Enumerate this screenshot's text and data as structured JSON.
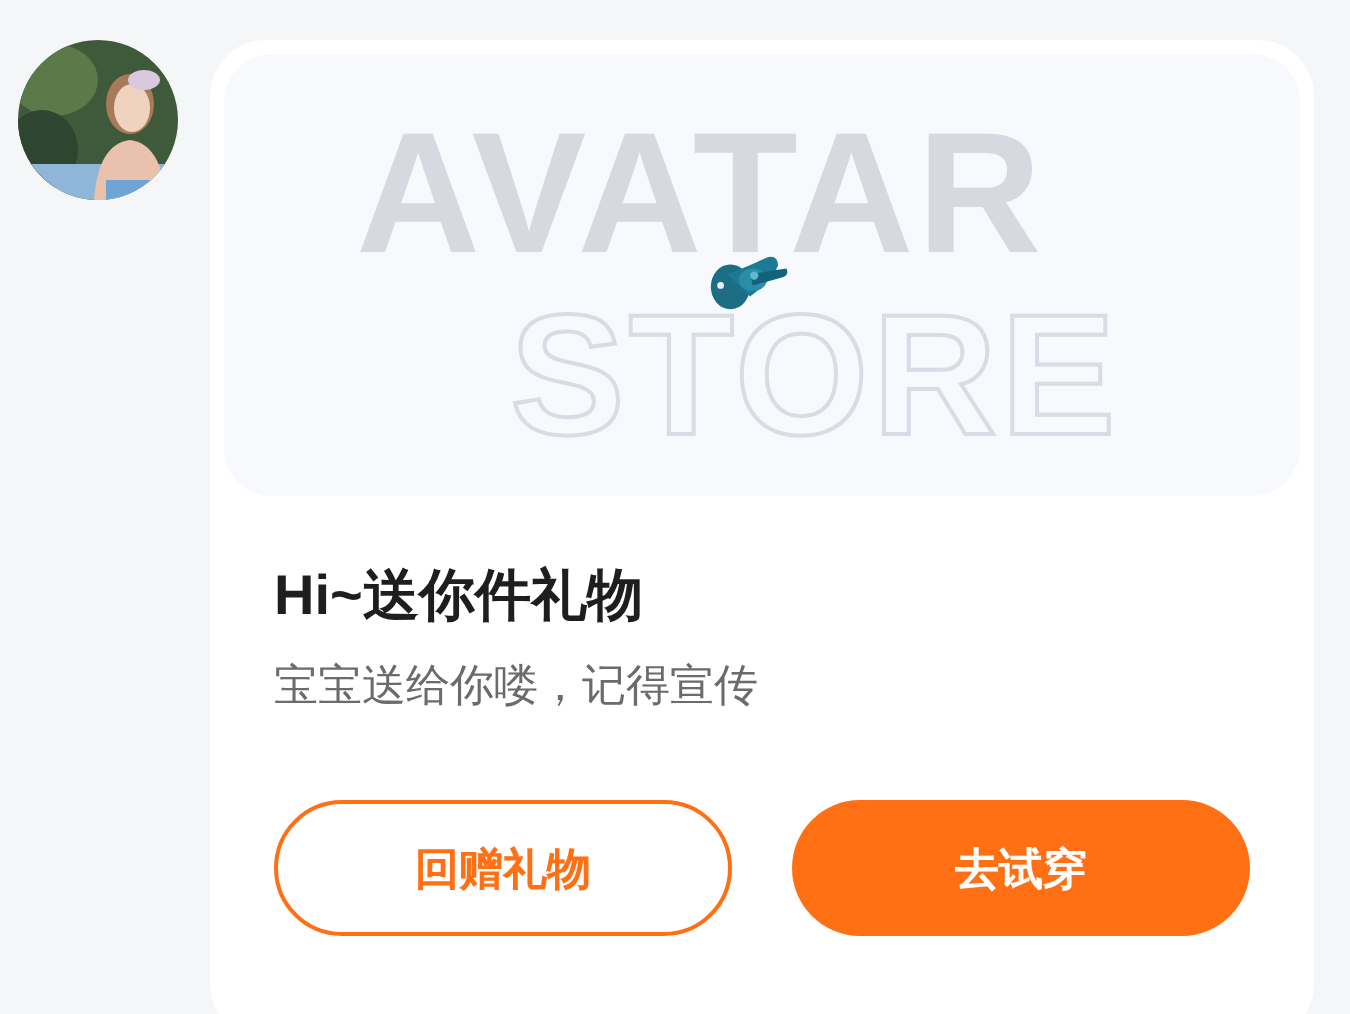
{
  "gift_card": {
    "background_text": [
      "AVATAR",
      "STORE"
    ],
    "title": "Hi~送你件礼物",
    "subtitle": "宝宝送给你喽，记得宣传",
    "buttons": [
      {
        "label": "回赠礼物",
        "kind": "outline"
      },
      {
        "label": "去试穿",
        "kind": "filled"
      }
    ]
  }
}
